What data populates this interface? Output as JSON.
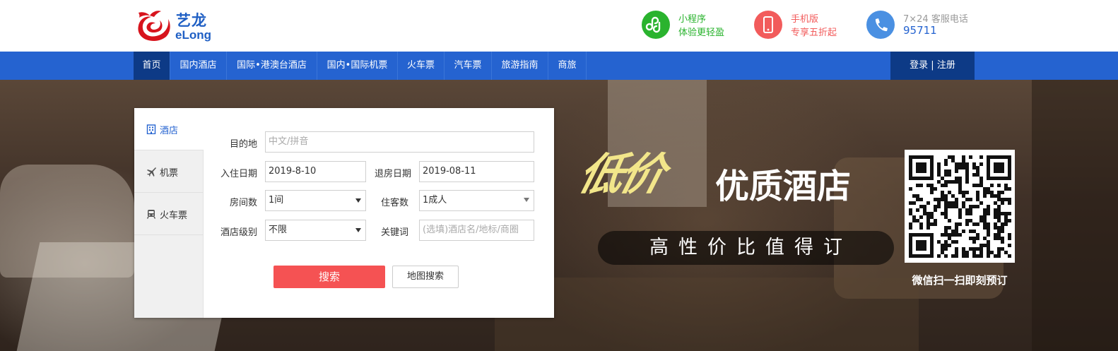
{
  "header": {
    "logo": {
      "name_cn": "艺龙",
      "name_en": "eLong"
    },
    "miniprogram": {
      "line1": "小程序",
      "line2": "体验更轻盈",
      "color": "#2ab32e"
    },
    "mobile": {
      "line1": "手机版",
      "line2": "专享五折起",
      "color": "#f25b5b"
    },
    "service": {
      "line1": "7×24 客服电话",
      "phone": "95711",
      "color": "#4a90e2"
    }
  },
  "nav": {
    "items": [
      "首页",
      "国内酒店",
      "国际•港澳台酒店",
      "国内•国际机票",
      "火车票",
      "汽车票",
      "旅游指南",
      "商旅"
    ],
    "active": "首页",
    "login": "登录 | 注册"
  },
  "search": {
    "tabs": [
      {
        "label": "酒店",
        "icon": "hotel-icon",
        "active": true
      },
      {
        "label": "机票",
        "icon": "plane-icon",
        "active": false
      },
      {
        "label": "火车票",
        "icon": "train-icon",
        "active": false
      }
    ],
    "destination": {
      "label": "目的地",
      "placeholder": "中文/拼音"
    },
    "checkin": {
      "label": "入住日期",
      "value": "2019-8-10"
    },
    "checkout": {
      "label": "退房日期",
      "value": "2019-08-11"
    },
    "rooms": {
      "label": "房间数",
      "value": "1间"
    },
    "guests": {
      "label": "住客数",
      "value": "1成人"
    },
    "star": {
      "label": "酒店级别",
      "value": "不限"
    },
    "keyword": {
      "label": "关键词",
      "placeholder": "(选填)酒店名/地标/商圈"
    },
    "search_button": "搜索",
    "map_button": "地图搜索"
  },
  "promo": {
    "cursive": "低价",
    "headline": "优质酒店",
    "tagline": "高性价比值得订",
    "qr_caption": "微信扫一扫即刻预订"
  }
}
